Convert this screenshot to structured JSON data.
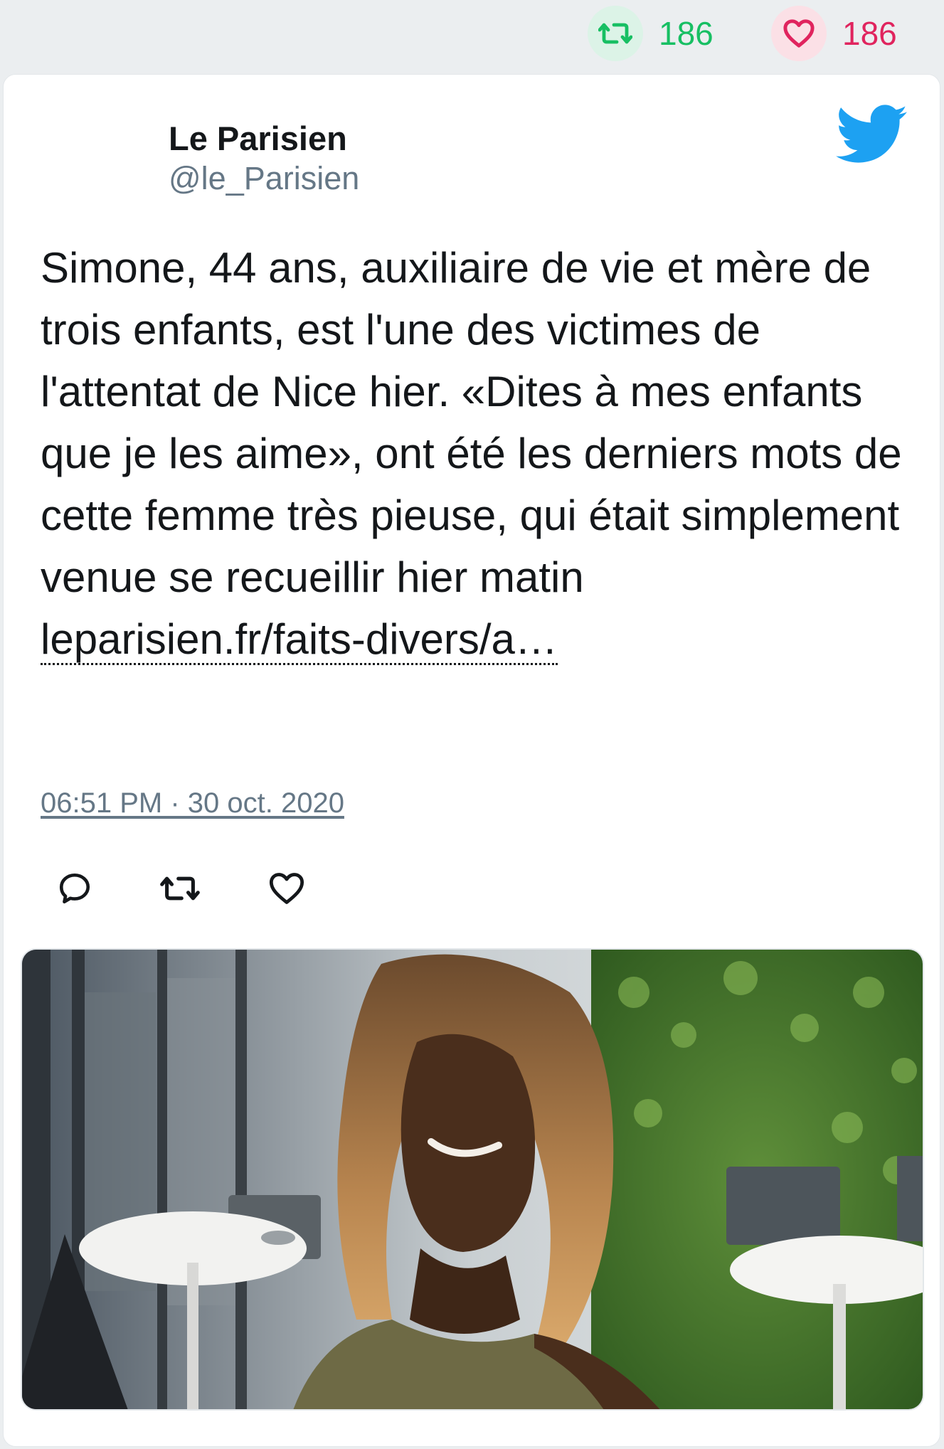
{
  "stats": {
    "retweet_count": "186",
    "like_count": "186",
    "retweet_color": "#17bf63",
    "like_color": "#e0245e"
  },
  "tweet": {
    "author_name": "Le Parisien",
    "author_handle": "@le_Parisien",
    "text": "Simone, 44 ans, auxiliaire de vie et mère de trois enfants, est l'une des victimes de l'attentat de Nice hier. «Dites à mes enfants que je les aime», ont été les derniers mots de cette femme très pieuse, qui était simplement venue se recueillir hier matin ",
    "link_text": "leparisien.fr/faits-divers/a…",
    "timestamp": "06:51 PM · 30 oct. 2020"
  },
  "icons": {
    "brand": "twitter-bird-icon",
    "reply": "reply-icon",
    "retweet": "retweet-icon",
    "like": "heart-icon",
    "brand_color": "#1da1f2"
  }
}
